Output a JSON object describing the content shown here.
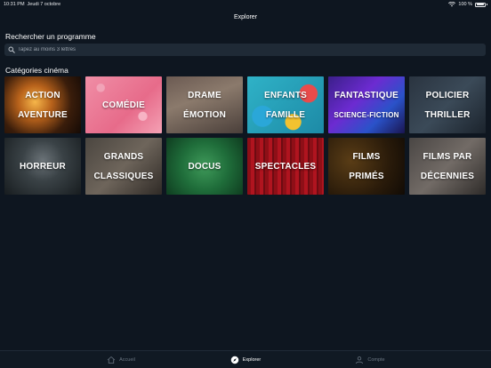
{
  "status": {
    "time": "10:31 PM",
    "date": "Jeudi 7 octobre",
    "battery": "100 %"
  },
  "nav": {
    "title": "Explorer"
  },
  "search": {
    "heading": "Rechercher un programme",
    "placeholder": "Tapez au moins 3 lettres"
  },
  "categories": {
    "heading": "Catégories cinéma",
    "tiles": [
      {
        "line1": "ACTION",
        "line2": "AVENTURE"
      },
      {
        "line1": "COMÉDIE",
        "line2": ""
      },
      {
        "line1": "DRAME",
        "line2": "ÉMOTION"
      },
      {
        "line1": "ENFANTS",
        "line2": "FAMILLE"
      },
      {
        "line1": "FANTASTIQUE",
        "line2": "SCIENCE-FICTION"
      },
      {
        "line1": "POLICIER",
        "line2": "THRILLER"
      },
      {
        "line1": "HORREUR",
        "line2": ""
      },
      {
        "line1": "GRANDS",
        "line2": "CLASSIQUES"
      },
      {
        "line1": "DOCUS",
        "line2": ""
      },
      {
        "line1": "SPECTACLES",
        "line2": ""
      },
      {
        "line1": "FILMS",
        "line2": "PRIMÉS"
      },
      {
        "line1": "FILMS PAR",
        "line2": "DÉCENNIES"
      }
    ]
  },
  "tabbar": {
    "home": "Accueil",
    "explore": "Explorer",
    "account": "Compte"
  },
  "icons": {
    "search": "search-icon",
    "home": "home-icon",
    "explore": "compass-icon",
    "account": "person-icon",
    "wifi": "wifi-icon",
    "battery": "battery-icon"
  }
}
